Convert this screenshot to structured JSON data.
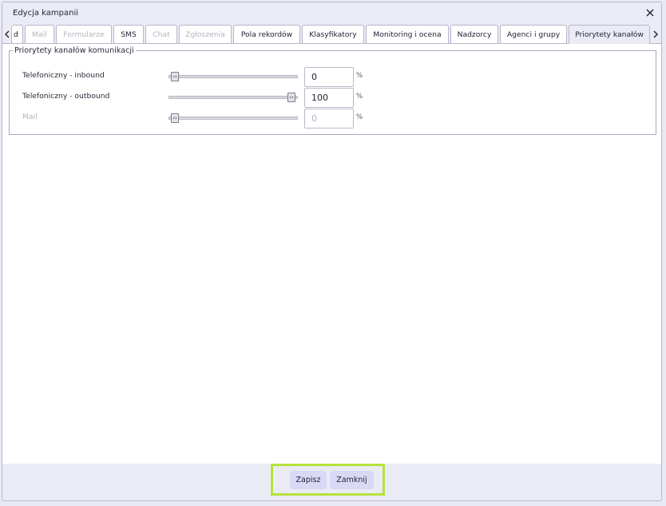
{
  "window": {
    "title": "Edycja kampanii"
  },
  "tabs": [
    {
      "label": "d",
      "disabled": false
    },
    {
      "label": "Mail",
      "disabled": true
    },
    {
      "label": "Formularze",
      "disabled": true
    },
    {
      "label": "SMS",
      "disabled": false
    },
    {
      "label": "Chat",
      "disabled": true
    },
    {
      "label": "Zgłoszenia",
      "disabled": true
    },
    {
      "label": "Pola rekordów",
      "disabled": false
    },
    {
      "label": "Klasyfikatory",
      "disabled": false
    },
    {
      "label": "Monitoring i ocena",
      "disabled": false
    },
    {
      "label": "Nadzorcy",
      "disabled": false
    },
    {
      "label": "Agenci i grupy",
      "disabled": false
    },
    {
      "label": "Priorytety kanałów",
      "disabled": false,
      "active": true
    }
  ],
  "priorities": {
    "legend": "Priorytety kanałów komunikacji",
    "rows": [
      {
        "label": "Telefoniczny - inbound",
        "value": "0",
        "unit": "%",
        "slider_fraction": 0.0,
        "disabled": false
      },
      {
        "label": "Telefoniczny - outbound",
        "value": "100",
        "unit": "%",
        "slider_fraction": 1.0,
        "disabled": false
      },
      {
        "label": "Mail",
        "value": "0",
        "unit": "%",
        "slider_fraction": 0.0,
        "disabled": true
      }
    ]
  },
  "footer": {
    "save_label": "Zapisz",
    "close_label": "Zamknij"
  },
  "colors": {
    "highlight": "#b5e33a",
    "button_bg": "#d9d9f5",
    "chrome_bg": "#ebebf5"
  }
}
